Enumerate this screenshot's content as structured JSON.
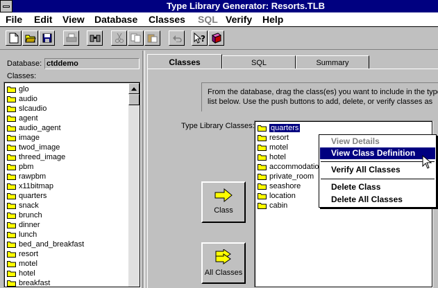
{
  "window": {
    "title": "Type Library Generator: Resorts.TLB"
  },
  "menu": [
    {
      "label": "File",
      "enabled": true
    },
    {
      "label": "Edit",
      "enabled": true
    },
    {
      "label": "View",
      "enabled": true
    },
    {
      "label": "Database",
      "enabled": true
    },
    {
      "label": "Classes",
      "enabled": true
    },
    {
      "label": "SQL",
      "enabled": false
    },
    {
      "label": "Verify",
      "enabled": true
    },
    {
      "label": "Help",
      "enabled": true
    }
  ],
  "toolbar_icons": [
    "new-document-icon",
    "open-folder-icon",
    "save-icon",
    "print-icon",
    "find-icon",
    "cut-icon",
    "copy-icon",
    "paste-icon",
    "undo-icon",
    "context-help-icon",
    "about-book-icon"
  ],
  "left": {
    "database_label": "Database:",
    "database_value": "ctddemo",
    "classes_label": "Classes:",
    "classes": [
      "glo",
      "audio",
      "slcaudio",
      "agent",
      "audio_agent",
      "image",
      "twod_image",
      "threed_image",
      "pbm",
      "rawpbm",
      "x11bitmap",
      "quarters",
      "snack",
      "brunch",
      "dinner",
      "lunch",
      "bed_and_breakfast",
      "resort",
      "motel",
      "hotel",
      "breakfast"
    ]
  },
  "tabs": [
    {
      "label": "Classes",
      "active": true
    },
    {
      "label": "SQL",
      "active": false
    },
    {
      "label": "Summary",
      "active": false
    }
  ],
  "instructions": {
    "line1": "From the database, drag the class(es) you want to include in the type l",
    "line2": "list below.  Use the push buttons to add, delete, or verify classes as"
  },
  "type_library": {
    "label": "Type Library Classes:",
    "classes": [
      "quarters",
      "resort",
      "motel",
      "hotel",
      "accommodation",
      "private_room",
      "seashore",
      "location",
      "cabin"
    ],
    "selected": "quarters"
  },
  "buttons": {
    "add_class": "Class",
    "add_all": "All Classes"
  },
  "context_menu": {
    "items": [
      {
        "label": "View Details",
        "enabled": false
      },
      {
        "label": "View Class Definition",
        "enabled": true,
        "highlighted": true
      },
      {
        "label": "Verify All Classes",
        "enabled": true
      },
      {
        "label": "Delete Class",
        "enabled": true
      },
      {
        "label": "Delete All Classes",
        "enabled": true
      }
    ]
  },
  "colors": {
    "titlebar": "#000080",
    "face": "#c0c0c0",
    "highlight": "#000080",
    "folder": "#ffff00"
  }
}
